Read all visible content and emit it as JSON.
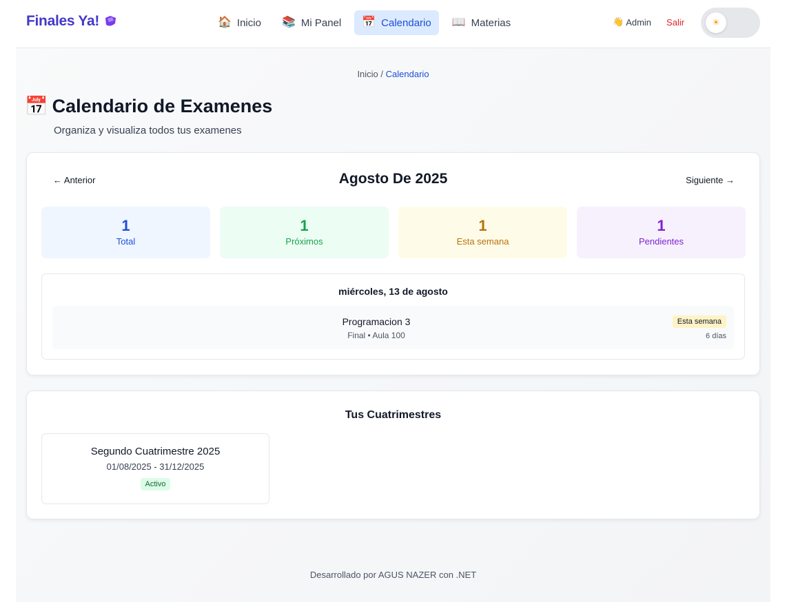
{
  "header": {
    "brand": "Finales Ya!",
    "nav": [
      {
        "icon": "house-icon",
        "emoji": "🏠",
        "label": "Inicio"
      },
      {
        "icon": "books-icon",
        "emoji": "📚",
        "label": "Mi Panel"
      },
      {
        "icon": "calendar-icon",
        "emoji": "📅",
        "label": "Calendario",
        "active": true
      },
      {
        "icon": "open-book-icon",
        "emoji": "📖",
        "label": "Materias"
      }
    ],
    "user_emoji": "👋",
    "user": "Admin",
    "logout": "Salir",
    "theme_toggle_icon": "☀"
  },
  "breadcrumb": {
    "home": "Inicio",
    "separator": "/",
    "current": "Calendario"
  },
  "page": {
    "title_emoji": "📅",
    "title": "Calendario de Examenes",
    "subtitle": "Organiza y visualiza todos tus examenes"
  },
  "calendar": {
    "prev": "← Anterior",
    "next": "Siguiente →",
    "month": "Agosto De 2025",
    "stats": [
      {
        "value": "1",
        "label": "Total"
      },
      {
        "value": "1",
        "label": "Próximos"
      },
      {
        "value": "1",
        "label": "Esta semana"
      },
      {
        "value": "1",
        "label": "Pendientes"
      }
    ],
    "day": "miércoles, 13 de agosto",
    "exam": {
      "subject": "Programacion 3",
      "meta": "Final • Aula 100",
      "badge": "Esta semana",
      "days": "6 días"
    }
  },
  "cuatrimestres": {
    "title": "Tus Cuatrimestres",
    "items": [
      {
        "name": "Segundo Cuatrimestre 2025",
        "dates": "01/08/2025 - 31/12/2025",
        "status": "Activo"
      }
    ]
  },
  "footer": "Desarrollado por AGUS NAZER con .NET",
  "colors": {
    "brand": "#4338ca",
    "active_nav_bg": "#dbeafe",
    "logout": "#dc2626"
  }
}
